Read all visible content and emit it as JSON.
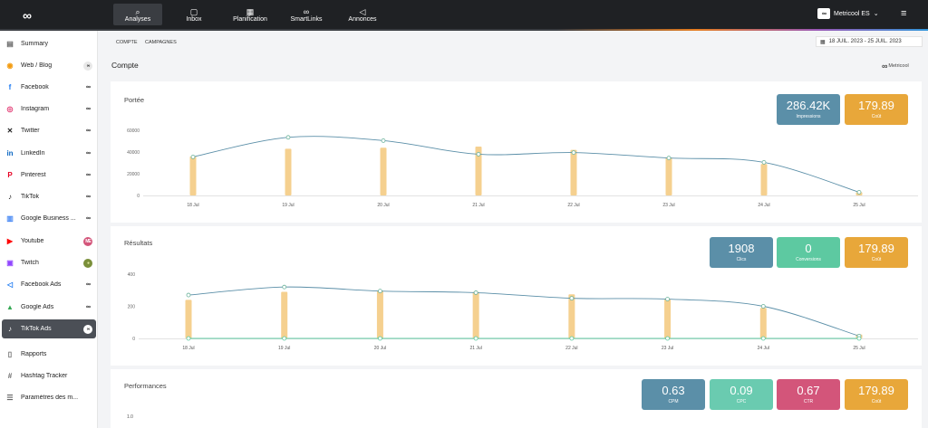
{
  "topbar": {
    "logo": "∞",
    "nav": [
      {
        "label": "Analyses",
        "icon": "⌕",
        "active": true
      },
      {
        "label": "Inbox",
        "icon": "▢"
      },
      {
        "label": "Planification",
        "icon": "▦"
      },
      {
        "label": "SmartLinks",
        "icon": "∞"
      },
      {
        "label": "Annonces",
        "icon": "◁"
      }
    ],
    "account_name": "Metricool ES",
    "account_logo": "∞",
    "chevron": "⌄",
    "menu_icon": "≡"
  },
  "sidebar": {
    "items": [
      {
        "label": "Summary",
        "icon": "▤",
        "icon_color": "#666",
        "badge": ""
      },
      {
        "label": "Web / Blog",
        "icon": "◉",
        "icon_color": "#f39c12",
        "badge": "∞"
      },
      {
        "label": "Facebook",
        "icon": "f",
        "icon_color": "#1877f2",
        "badge": "∞"
      },
      {
        "label": "Instagram",
        "icon": "◎",
        "icon_color": "#e1306c",
        "badge": "∞"
      },
      {
        "label": "Twitter",
        "icon": "✕",
        "icon_color": "#222",
        "badge": "∞"
      },
      {
        "label": "LinkedIn",
        "icon": "in",
        "icon_color": "#0a66c2",
        "badge": "∞"
      },
      {
        "label": "Pinterest",
        "icon": "P",
        "icon_color": "#e60023",
        "badge": "∞"
      },
      {
        "label": "TikTok",
        "icon": "♪",
        "icon_color": "#111",
        "badge": "∞"
      },
      {
        "label": "Google Business ...",
        "icon": "▥",
        "icon_color": "#4285f4",
        "badge": "∞"
      },
      {
        "label": "Youtube",
        "icon": "▶",
        "icon_color": "#ff0000",
        "badge": "ME"
      },
      {
        "label": "Twitch",
        "icon": "▣",
        "icon_color": "#9146ff",
        "badge": "●"
      },
      {
        "label": "Facebook Ads",
        "icon": "◁",
        "icon_color": "#1877f2",
        "badge": "∞"
      },
      {
        "label": "Google Ads",
        "icon": "▲",
        "icon_color": "#34a853",
        "badge": "∞"
      },
      {
        "label": "TikTok Ads",
        "icon": "♪",
        "icon_color": "#fff",
        "badge": "∞",
        "active": true
      },
      {
        "label": "Rapports",
        "icon": "▯",
        "icon_color": "#666",
        "badge": ""
      },
      {
        "label": "Hashtag Tracker",
        "icon": "#",
        "icon_color": "#666",
        "badge": ""
      },
      {
        "label": "Paramètres des m...",
        "icon": "☰",
        "icon_color": "#666",
        "badge": ""
      }
    ]
  },
  "breadcrumb": {
    "item1": "COMPTE",
    "item2": "CAMPAGNES"
  },
  "date_range": {
    "icon": "▦",
    "text": "18 JUIL. 2023 - 25 JUIL. 2023"
  },
  "page_title": "Compte",
  "brand_label": "Metricool",
  "colors": {
    "bar": "#f5d08f",
    "line": "#5b8fa8",
    "green_line": "#5dc9a1",
    "kpi_blue": "#5b8fa8",
    "kpi_orange": "#e8a73a",
    "kpi_green": "#5dc9a1",
    "kpi_pink": "#d3557a"
  },
  "panels": {
    "portee": {
      "title": "Portée",
      "kpis": [
        {
          "value": "286.42K",
          "label": "Impressions",
          "color": "blue"
        },
        {
          "value": "179.89",
          "label": "Coût",
          "color": "orange"
        }
      ]
    },
    "resultats": {
      "title": "Résultats",
      "kpis": [
        {
          "value": "1908",
          "label": "Clics",
          "color": "blue"
        },
        {
          "value": "0",
          "label": "Conversions",
          "color": "green"
        },
        {
          "value": "179.89",
          "label": "Coût",
          "color": "orange"
        }
      ]
    },
    "performances": {
      "title": "Performances",
      "kpis": [
        {
          "value": "0.63",
          "label": "CPM",
          "color": "blue"
        },
        {
          "value": "0.09",
          "label": "CPC",
          "color": "teal"
        },
        {
          "value": "0.67",
          "label": "CTR",
          "color": "pink"
        },
        {
          "value": "179.89",
          "label": "Coût",
          "color": "orange"
        }
      ],
      "y_tick": "1.0"
    }
  },
  "chart_data": [
    {
      "type": "bar",
      "categories": [
        "18 Jul",
        "19 Jul",
        "20 Jul",
        "21 Jul",
        "22 Jul",
        "23 Jul",
        "24 Jul",
        "25 Jul"
      ],
      "yticks": [
        0,
        20000,
        40000,
        60000
      ],
      "ylim": [
        0,
        65000
      ],
      "series": [
        {
          "type": "bar",
          "values": [
            36000,
            43000,
            44000,
            45000,
            42000,
            35000,
            29000,
            3000
          ]
        },
        {
          "type": "line",
          "values": [
            35500,
            53500,
            50500,
            38000,
            39500,
            34500,
            30500,
            3000
          ]
        }
      ]
    },
    {
      "type": "bar",
      "categories": [
        "18 Jul",
        "19 Jul",
        "20 Jul",
        "21 Jul",
        "22 Jul",
        "23 Jul",
        "24 Jul",
        "25 Jul"
      ],
      "yticks": [
        0,
        200,
        400
      ],
      "ylim": [
        0,
        400
      ],
      "series": [
        {
          "type": "bar",
          "values": [
            240,
            290,
            295,
            290,
            275,
            245,
            190,
            25
          ]
        },
        {
          "type": "line",
          "values": [
            270,
            320,
            295,
            285,
            250,
            245,
            200,
            15
          ]
        },
        {
          "type": "line",
          "values": [
            0,
            0,
            0,
            0,
            0,
            0,
            0,
            0
          ]
        }
      ]
    }
  ]
}
